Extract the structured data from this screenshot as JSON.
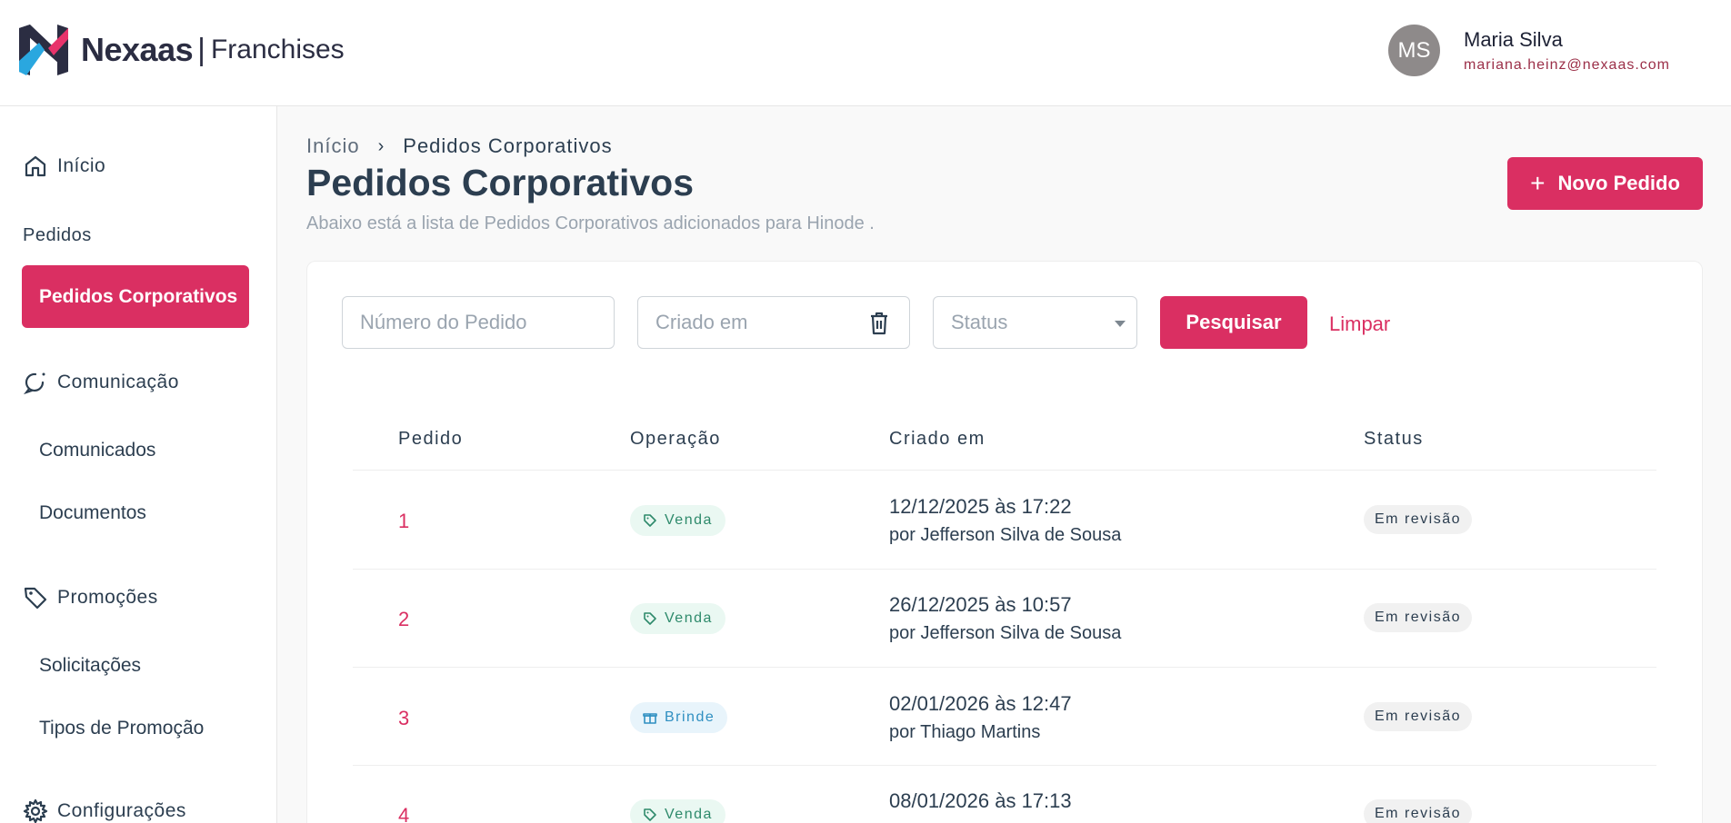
{
  "header": {
    "brand": "Nexaas",
    "separator": "|",
    "brand_sub": "Franchises",
    "user": {
      "initials": "MS",
      "name": "Maria Silva",
      "email": "mariana.heinz@nexaas.com"
    }
  },
  "sidebar": {
    "home": "Início",
    "pedidos_label": "Pedidos",
    "active_item": "Pedidos Corporativos",
    "comunicacao": "Comunicação",
    "comunicados": "Comunicados",
    "documentos": "Documentos",
    "promocoes": "Promoções",
    "solicitacoes": "Solicitações",
    "tipos_promocao": "Tipos de Promoção",
    "configuracoes": "Configurações"
  },
  "breadcrumb": {
    "home": "Início",
    "current": "Pedidos Corporativos"
  },
  "page": {
    "title": "Pedidos Corporativos",
    "subtitle": "Abaixo está a lista de Pedidos Corporativos adicionados para Hinode .",
    "new_button": "Novo Pedido"
  },
  "filters": {
    "order_number_placeholder": "Número do Pedido",
    "created_placeholder": "Criado em",
    "status_placeholder": "Status",
    "search_button": "Pesquisar",
    "clear_link": "Limpar"
  },
  "table": {
    "headers": [
      "Pedido",
      "Operação",
      "Criado em",
      "Status"
    ],
    "rows": [
      {
        "id": "1",
        "operation": "Venda",
        "date": "12/12/2025 às 17:22",
        "by": "por Jefferson Silva de Sousa",
        "status": "Em revisão"
      },
      {
        "id": "2",
        "operation": "Venda",
        "date": "26/12/2025 às 10:57",
        "by": "por Jefferson Silva de Sousa",
        "status": "Em revisão"
      },
      {
        "id": "3",
        "operation": "Brinde",
        "date": "02/01/2026 às 12:47",
        "by": "por Thiago Martins",
        "status": "Em revisão"
      },
      {
        "id": "4",
        "operation": "Venda",
        "date": "08/01/2026 às 17:13",
        "by": "",
        "status": "Em revisão"
      }
    ]
  },
  "colors": {
    "accent": "#da2f62",
    "text": "#2c3e50",
    "venda_bg": "#eaf8f2",
    "brinde_bg": "#e8f4fb"
  },
  "icons": [
    "nexaas-logo",
    "home-icon",
    "chat-icon",
    "tag-icon",
    "gear-icon",
    "chevron-right-icon",
    "plus-icon",
    "trash-icon",
    "caret-down-icon",
    "gift-icon"
  ]
}
